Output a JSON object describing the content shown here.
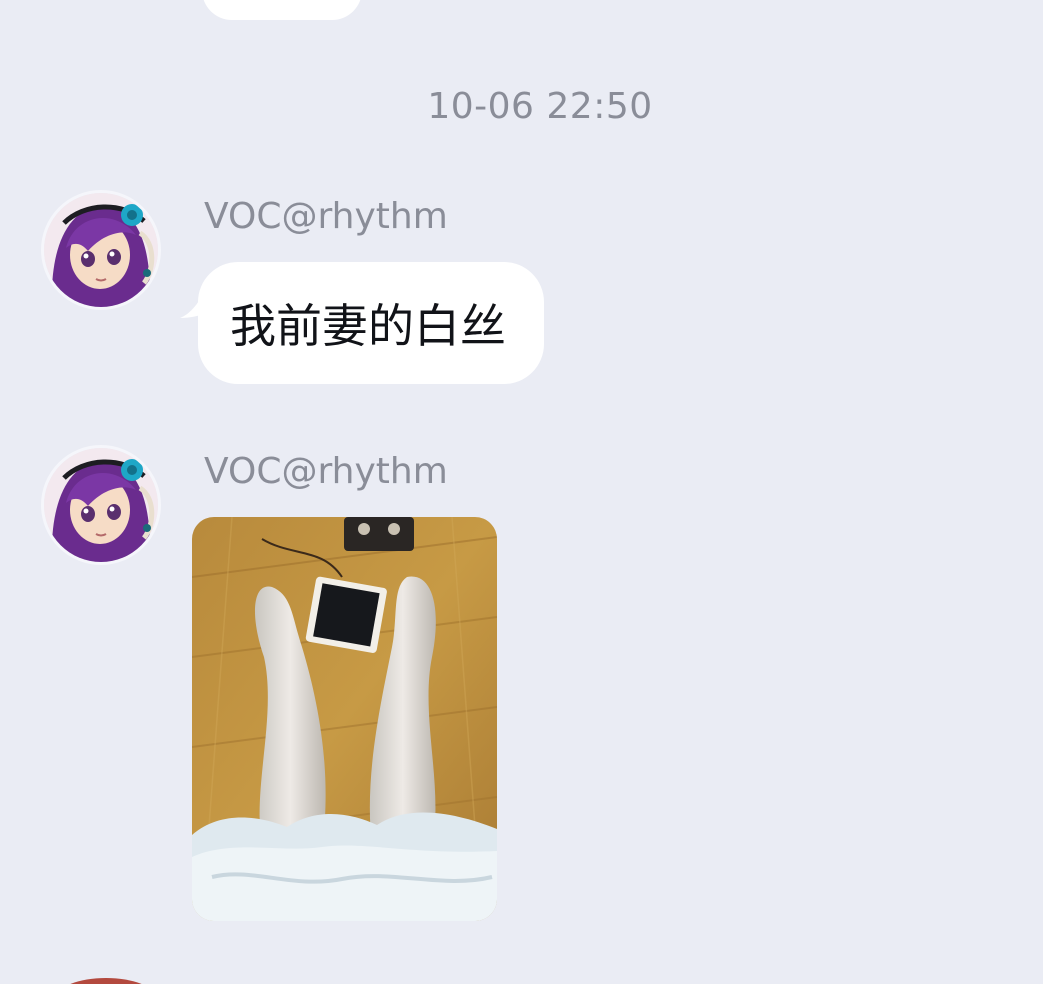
{
  "conversation": {
    "timestamp": "10-06 22:50",
    "messages": [
      {
        "sender": "VOC@rhythm",
        "avatar_icon": "anime-girl-avatar-icon",
        "type": "text",
        "text": "我前妻的白丝"
      },
      {
        "sender": "VOC@rhythm",
        "avatar_icon": "anime-girl-avatar-icon",
        "type": "image",
        "image_icon": "photo-thumbnail-icon"
      }
    ]
  },
  "colors": {
    "background": "#eaecf4",
    "bubble": "#ffffff",
    "meta_text": "#8a8d98",
    "message_text": "#111318"
  }
}
